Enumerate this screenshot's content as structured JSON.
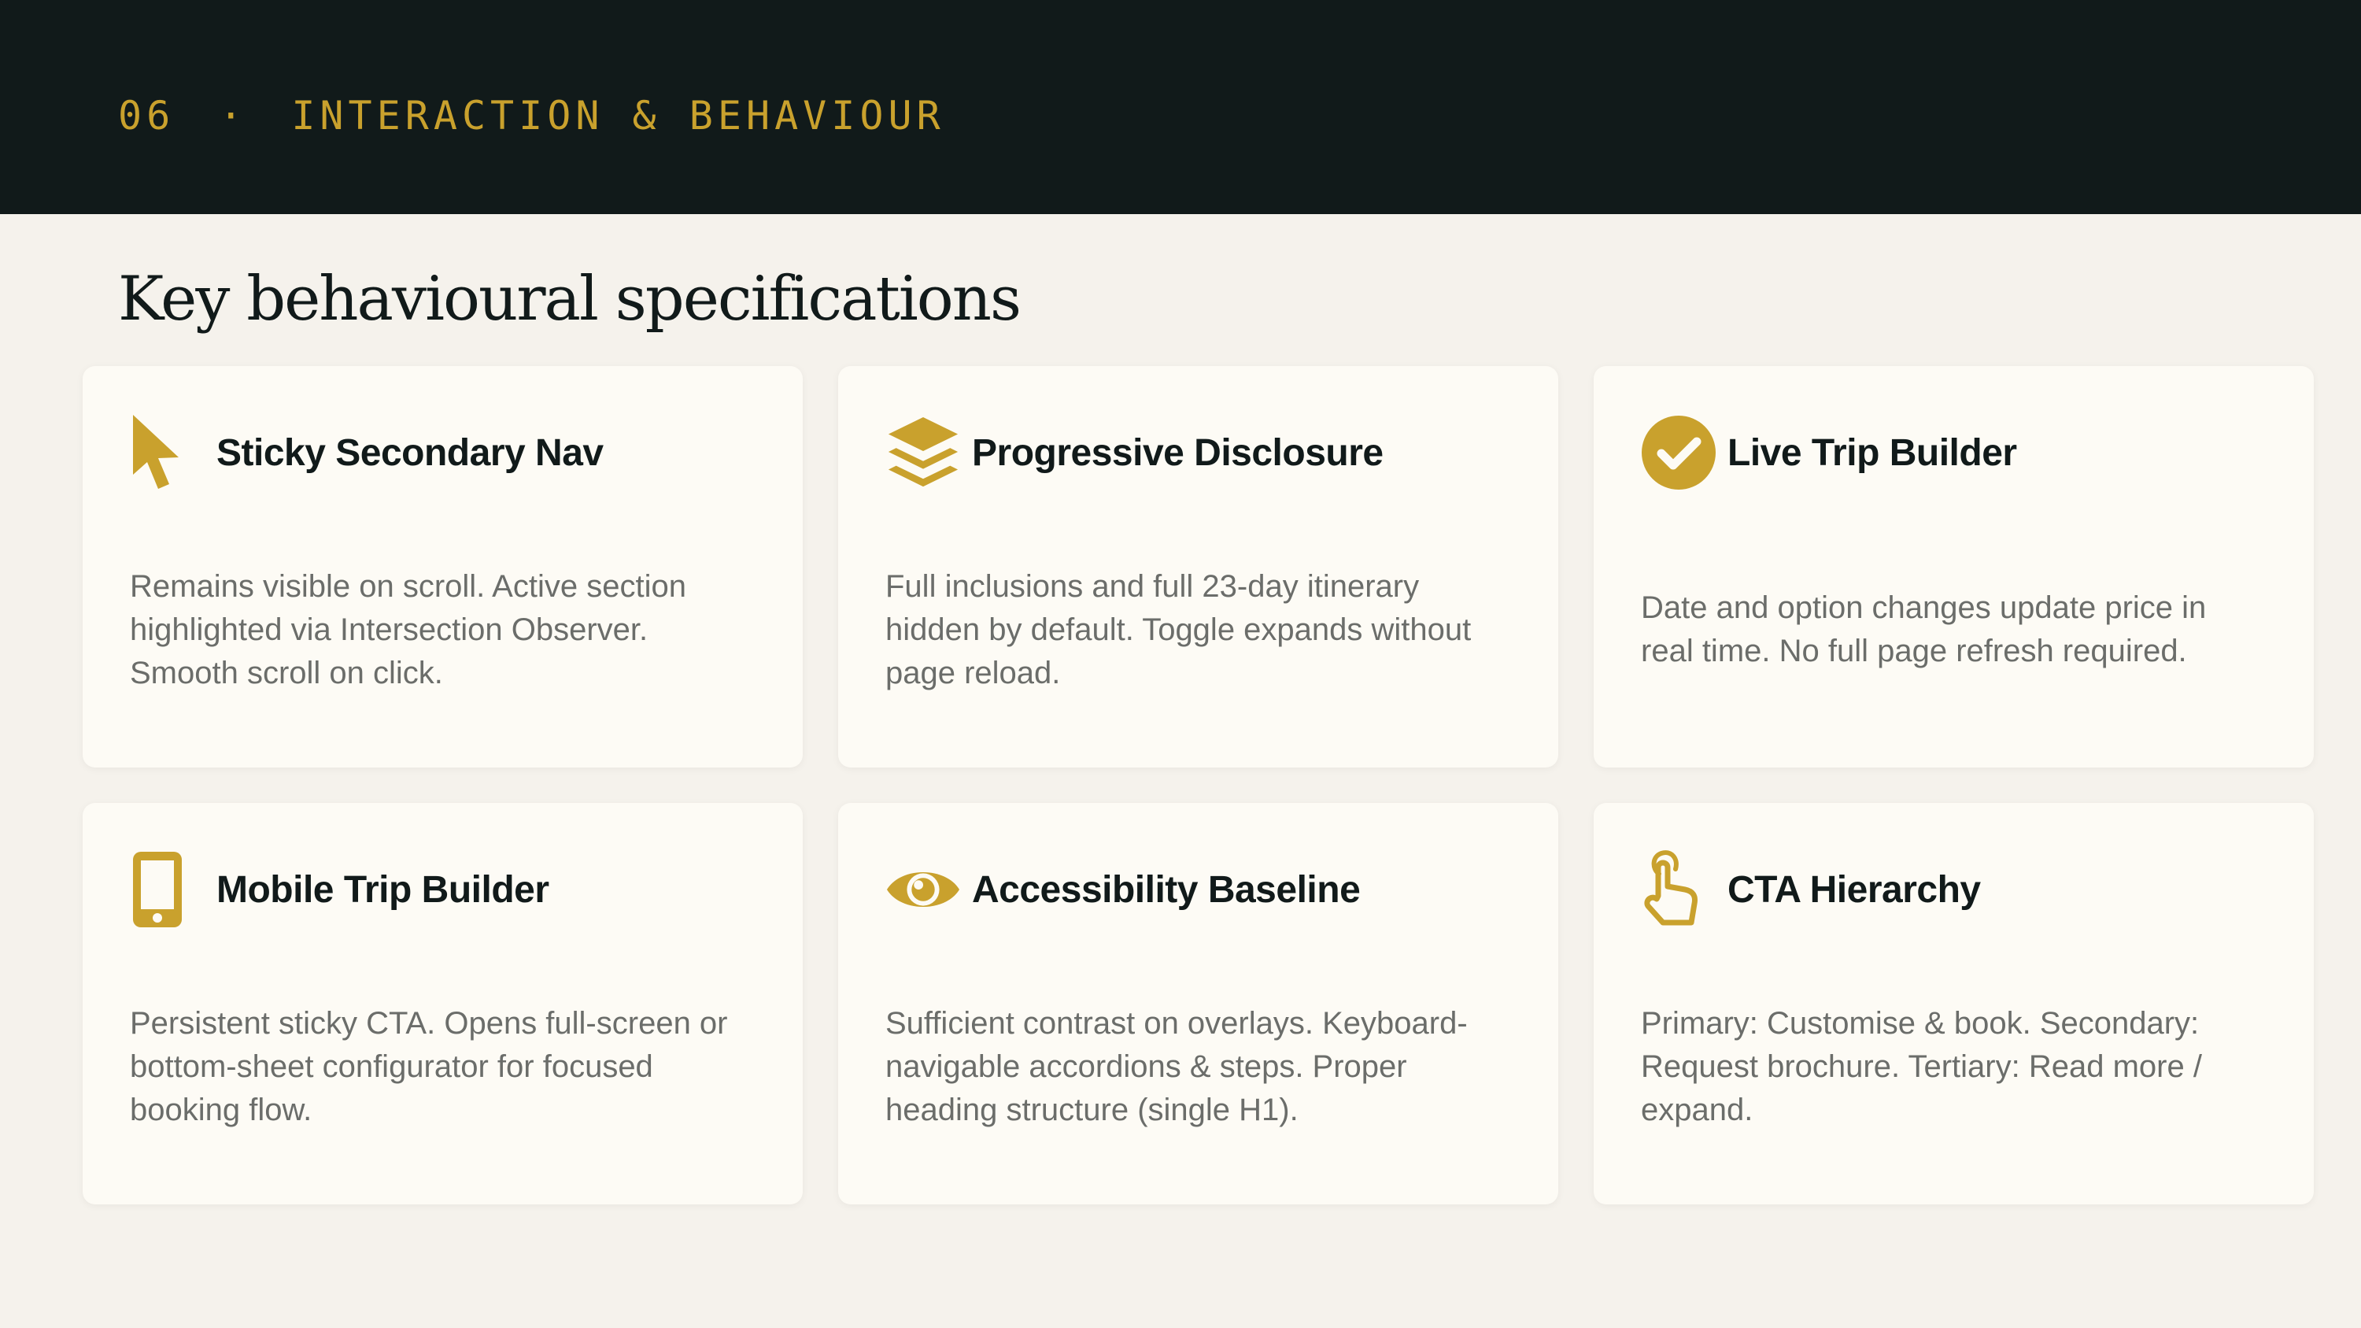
{
  "header": {
    "section_number": "06",
    "separator": "·",
    "section_label": "INTERACTION & BEHAVIOUR"
  },
  "page": {
    "title": "Key behavioural specifications"
  },
  "colors": {
    "accent": "#c9a12d",
    "header_background": "#111a1a",
    "page_background": "#f5f2ec",
    "card_background": "#fdfbf5",
    "body_text": "#6b6d6a"
  },
  "cards": [
    {
      "icon": "cursor-arrow-icon",
      "title": "Sticky Secondary Nav",
      "description": "Remains visible on scroll. Active section highlighted via Intersection Observer. Smooth scroll on click."
    },
    {
      "icon": "layers-icon",
      "title": "Progressive Disclosure",
      "description": "Full inclusions and full 23-day itinerary hidden by default. Toggle expands without page reload."
    },
    {
      "icon": "check-circle-icon",
      "title": "Live Trip Builder",
      "description": "Date and option changes update price in real time. No full page refresh required."
    },
    {
      "icon": "mobile-phone-icon",
      "title": "Mobile Trip Builder",
      "description": "Persistent sticky CTA. Opens full-screen or bottom-sheet configurator for focused booking flow."
    },
    {
      "icon": "eye-icon",
      "title": "Accessibility Baseline",
      "description": "Sufficient contrast on overlays. Keyboard-navigable accordions & steps. Proper heading structure (single H1)."
    },
    {
      "icon": "hand-pointer-icon",
      "title": "CTA Hierarchy",
      "description": "Primary: Customise & book. Secondary: Request brochure. Tertiary: Read more / expand."
    }
  ]
}
